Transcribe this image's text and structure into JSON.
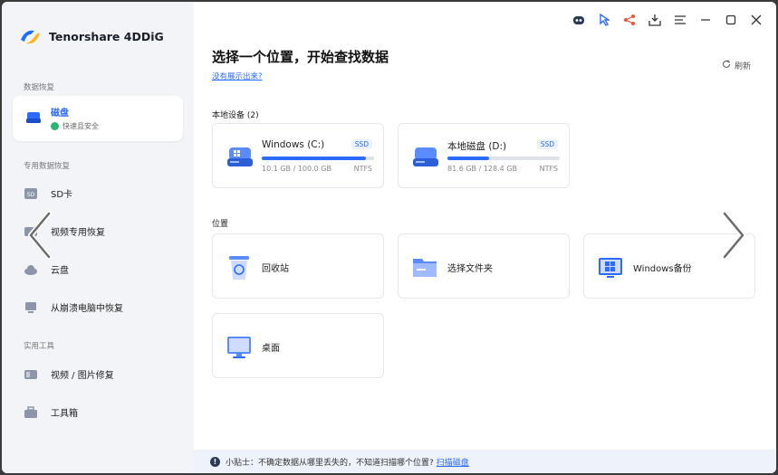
{
  "app": {
    "name": "Tenorshare 4DDiG"
  },
  "sidebar": {
    "section_data_recovery": "数据恢复",
    "disk": {
      "label": "磁盘",
      "sub": "快速且安全"
    },
    "section_special": "专用数据恢复",
    "items_special": [
      {
        "label": "SD卡",
        "icon": "sd-card-icon"
      },
      {
        "label": "视频专用恢复",
        "icon": "video-icon"
      },
      {
        "label": "云盘",
        "icon": "cloud-icon"
      },
      {
        "label": "从崩溃电脑中恢复",
        "icon": "crashed-pc-icon"
      }
    ],
    "section_tools": "实用工具",
    "items_tools": [
      {
        "label": "视频 / 图片修复",
        "icon": "repair-icon"
      },
      {
        "label": "工具箱",
        "icon": "toolbox-icon"
      }
    ]
  },
  "main": {
    "title": "选择一个位置，开始查找数据",
    "not_shown_link": "没有展示出来?",
    "refresh": "刷新",
    "local_devices_label": "本地设备 (2)",
    "disks": [
      {
        "name": "Windows (C:)",
        "badge": "SSD",
        "used_fraction": 0.93,
        "size": "10.1 GB / 100.0 GB",
        "fs": "NTFS"
      },
      {
        "name": "本地磁盘 (D:)",
        "badge": "SSD",
        "used_fraction": 0.37,
        "size": "81.6 GB / 128.4 GB",
        "fs": "NTFS"
      }
    ],
    "location_label": "位置",
    "locations": [
      {
        "label": "回收站",
        "icon": "recycle-bin-icon"
      },
      {
        "label": "选择文件夹",
        "icon": "folder-icon"
      },
      {
        "label": "Windows备份",
        "icon": "windows-backup-icon"
      },
      {
        "label": "桌面",
        "icon": "desktop-icon"
      }
    ]
  },
  "footer": {
    "tip": "小贴士：不确定数据从哪里丢失的，不知道扫描哪个位置?",
    "link": "扫描磁盘"
  },
  "colors": {
    "accent": "#2b6bff",
    "sidebar_bg": "#f2f4f7",
    "footer_bg": "#eef2fb"
  }
}
